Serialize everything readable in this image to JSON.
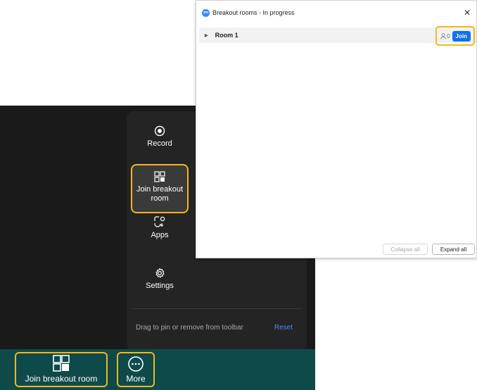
{
  "dialog": {
    "title": "Breakout rooms - In progress",
    "logo_text": "zm",
    "close_glyph": "✕",
    "rooms": [
      {
        "name": "Room 1",
        "participants": "0",
        "join_label": "Join"
      }
    ],
    "collapse_all_label": "Collapse all",
    "expand_all_label": "Expand all"
  },
  "menu": {
    "items": [
      {
        "label": "Record",
        "icon": "record-icon"
      },
      {
        "label": "Join breakout room",
        "icon": "breakout-room-icon"
      },
      {
        "label": "Apps",
        "icon": "apps-icon"
      },
      {
        "label": "Settings",
        "icon": "gear-icon"
      }
    ],
    "footer_text": "Drag to pin or remove from toolbar",
    "reset_label": "Reset"
  },
  "toolbar": {
    "breakout_label": "Join breakout room",
    "more_label": "More"
  },
  "colors": {
    "highlight": "#f2b623",
    "toolbar_bg": "#0f4a4a",
    "join_blue": "#0e72ed",
    "menu_bg": "#242424"
  }
}
